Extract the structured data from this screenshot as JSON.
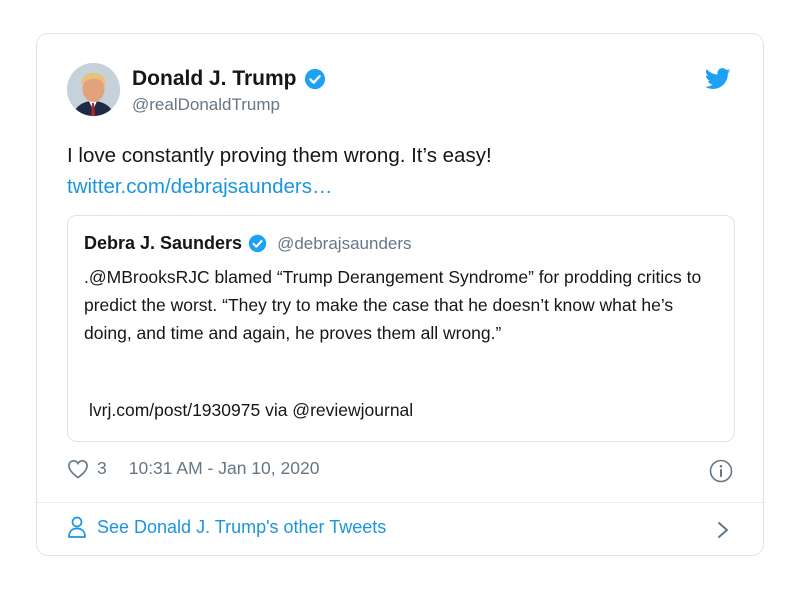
{
  "tweet": {
    "author_name": "Donald J. Trump",
    "author_handle": "@realDonaldTrump",
    "text": "I love constantly proving them wrong. It’s easy!",
    "link": "twitter.com/debrajsaunders…",
    "likes": "3",
    "timestamp": "10:31 AM - Jan 10, 2020"
  },
  "quote": {
    "author_name": "Debra J. Saunders",
    "author_handle": "@debrajsaunders",
    "text": ".@MBrooksRJC blamed “Trump Derangement Syndrome” for prodding critics to predict the worst. “They try to make the case that he doesn’t know what he’s doing, and time and again, he proves them all wrong.”",
    "source": "lvrj.com/post/1930975 via @reviewjournal"
  },
  "footer": {
    "label": "See Donald J. Trump's other Tweets"
  },
  "colors": {
    "accent": "#1b95e0",
    "verified": "#1da1f2",
    "secondary_text": "#657786",
    "border": "#dfe3e8"
  },
  "icons": {
    "brand": "twitter-bird-icon",
    "verified": "verified-badge-icon",
    "like": "heart-icon",
    "info": "info-icon",
    "profile": "person-icon",
    "more": "chevron-right-icon"
  }
}
